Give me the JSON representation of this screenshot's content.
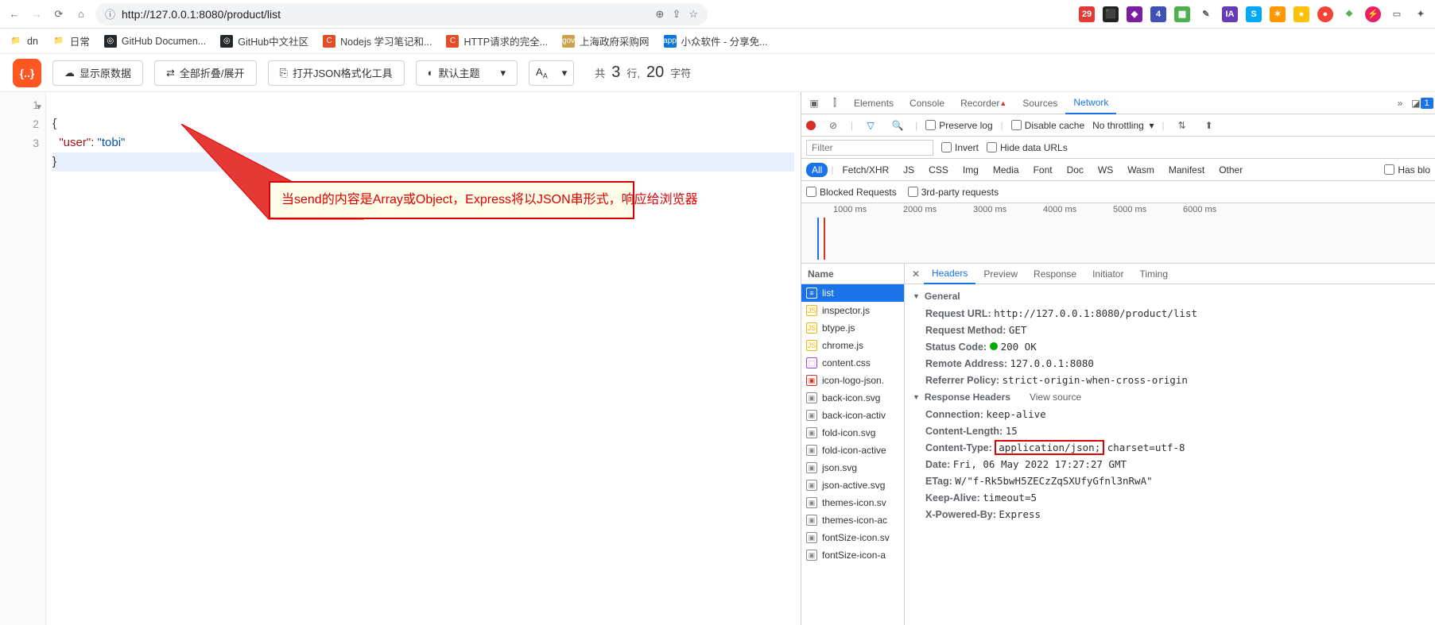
{
  "browser": {
    "url": "http://127.0.0.1:8080/product/list",
    "bookmarks": [
      {
        "label": "dn",
        "icon": "folder",
        "color": "#ffcc66"
      },
      {
        "label": "日常",
        "icon": "folder",
        "color": "#ffcc66"
      },
      {
        "label": "GitHub Documen...",
        "icon": "gh",
        "color": "#24292e"
      },
      {
        "label": "GitHub中文社区",
        "icon": "gh",
        "color": "#24292e"
      },
      {
        "label": "Nodejs 学习笔记和...",
        "icon": "C",
        "color": "#e44d26"
      },
      {
        "label": "HTTP请求的完全...",
        "icon": "C",
        "color": "#e44d26"
      },
      {
        "label": "上海政府采购网",
        "icon": "gov",
        "color": "#c9a24a"
      },
      {
        "label": "小众软件 - 分享免...",
        "icon": "app",
        "color": "#0b76d8"
      }
    ],
    "ext_badge": "29",
    "ext_badge2": "4"
  },
  "json_toolbar": {
    "raw_btn": "显示原数据",
    "collapse_btn": "全部折叠/展开",
    "format_btn": "打开JSON格式化工具",
    "theme_btn": "默认主题",
    "lines_label": "共",
    "lines": "3",
    "lines_suffix": "行,",
    "chars": "20",
    "chars_suffix": "字符"
  },
  "code": {
    "lines": [
      "1",
      "2",
      "3"
    ],
    "json_text": "{\n  \"user\": \"tobi\"\n}",
    "key": "\"user\"",
    "val": "\"tobi\""
  },
  "callout": "当send的内容是Array或Object，Express将以JSON串形式，响应给浏览器",
  "devtools": {
    "tabs": [
      "Elements",
      "Console",
      "Recorder",
      "Sources",
      "Network"
    ],
    "active_tab": "Network",
    "notify_count": "1",
    "toolbar": {
      "preserve": "Preserve log",
      "disable": "Disable cache",
      "throttle": "No throttling"
    },
    "filter_placeholder": "Filter",
    "invert": "Invert",
    "hide_urls": "Hide data URLs",
    "types": [
      "All",
      "Fetch/XHR",
      "JS",
      "CSS",
      "Img",
      "Media",
      "Font",
      "Doc",
      "WS",
      "Wasm",
      "Manifest",
      "Other"
    ],
    "has_blocked": "Has blo",
    "blocked": "Blocked Requests",
    "thirdparty": "3rd-party requests",
    "timeline": [
      "1000 ms",
      "2000 ms",
      "3000 ms",
      "4000 ms",
      "5000 ms",
      "6000 ms"
    ],
    "name_header": "Name",
    "requests": [
      {
        "name": "list",
        "type": "doc",
        "sel": true
      },
      {
        "name": "inspector.js",
        "type": "js"
      },
      {
        "name": "btype.js",
        "type": "js"
      },
      {
        "name": "chrome.js",
        "type": "js"
      },
      {
        "name": "content.css",
        "type": "css"
      },
      {
        "name": "icon-logo-json.",
        "type": "img"
      },
      {
        "name": "back-icon.svg",
        "type": "svg"
      },
      {
        "name": "back-icon-activ",
        "type": "svg"
      },
      {
        "name": "fold-icon.svg",
        "type": "svg"
      },
      {
        "name": "fold-icon-active",
        "type": "svg"
      },
      {
        "name": "json.svg",
        "type": "svg"
      },
      {
        "name": "json-active.svg",
        "type": "svg"
      },
      {
        "name": "themes-icon.sv",
        "type": "svg"
      },
      {
        "name": "themes-icon-ac",
        "type": "svg"
      },
      {
        "name": "fontSize-icon.sv",
        "type": "svg"
      },
      {
        "name": "fontSize-icon-a",
        "type": "svg"
      }
    ],
    "detail_tabs": [
      "Headers",
      "Preview",
      "Response",
      "Initiator",
      "Timing"
    ],
    "detail_active": "Headers",
    "general": {
      "title": "General",
      "url_k": "Request URL:",
      "url_v": "http://127.0.0.1:8080/product/list",
      "method_k": "Request Method:",
      "method_v": "GET",
      "status_k": "Status Code:",
      "status_v": "200 OK",
      "remote_k": "Remote Address:",
      "remote_v": "127.0.0.1:8080",
      "referrer_k": "Referrer Policy:",
      "referrer_v": "strict-origin-when-cross-origin"
    },
    "response_headers": {
      "title": "Response Headers",
      "view_source": "View source",
      "items": [
        {
          "k": "Connection:",
          "v": "keep-alive"
        },
        {
          "k": "Content-Length:",
          "v": "15"
        },
        {
          "k": "Content-Type:",
          "v": "application/json;",
          "v2": "charset=utf-8",
          "hl": true
        },
        {
          "k": "Date:",
          "v": "Fri, 06 May 2022 17:27:27 GMT"
        },
        {
          "k": "ETag:",
          "v": "W/\"f-Rk5bwH5ZECzZqSXUfyGfnl3nRwA\""
        },
        {
          "k": "Keep-Alive:",
          "v": "timeout=5"
        },
        {
          "k": "X-Powered-By:",
          "v": "Express"
        }
      ]
    }
  }
}
